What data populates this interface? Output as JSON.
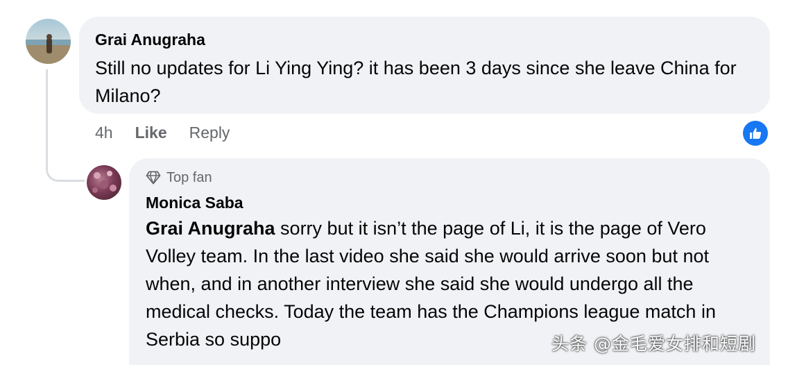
{
  "comment": {
    "author": "Grai Anugraha",
    "text": "Still no updates for Li Ying Ying? it has been 3 days since she leave China for Milano?",
    "time": "4h",
    "like_label": "Like",
    "reply_label": "Reply",
    "reaction_icon": "thumbs-up-icon",
    "reaction_color": "#1877f2"
  },
  "reply": {
    "badge": "Top fan",
    "badge_icon": "diamond-icon",
    "author": "Monica Saba",
    "mention": "Grai Anugraha",
    "text": " sorry but it isn’t the page of Li, it is the page of Vero Volley team. In the last video she said she would arrive soon but not when, and in another interview she said she would undergo all the medical checks. Today the team has the Champions league match in Serbia so suppo"
  },
  "watermark": "头条 @金毛爱女排和短剧"
}
